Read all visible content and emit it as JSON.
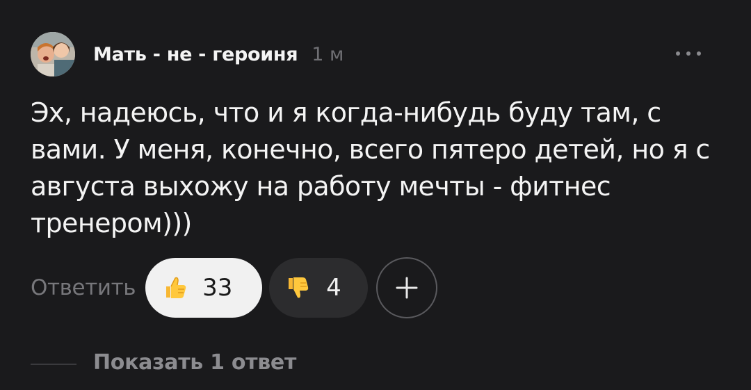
{
  "comment": {
    "author": "Мать - не - героиня",
    "time": "1 м",
    "text": "Эх, надеюсь, что и я когда-нибудь буду там, с вами. У меня, конечно, всего пятеро детей, но я с августа выхожу на работу мечты - фитнес тренером)))",
    "avatar_icon": "user-photo-avatar",
    "more_icon": "more-horizontal-icon"
  },
  "actions": {
    "reply_label": "Ответить",
    "like": {
      "icon": "thumbs-up-emoji",
      "count": "33"
    },
    "dislike": {
      "icon": "thumbs-down-emoji",
      "count": "4"
    },
    "add_reaction_icon": "plus-icon"
  },
  "thread": {
    "show_replies_label": "Показать 1 ответ"
  },
  "colors": {
    "background": "#1a1a1c",
    "text": "#f4f4f4",
    "muted": "#77777b",
    "like_pill": "#f1f1f1",
    "dislike_pill": "#2c2c2e"
  }
}
